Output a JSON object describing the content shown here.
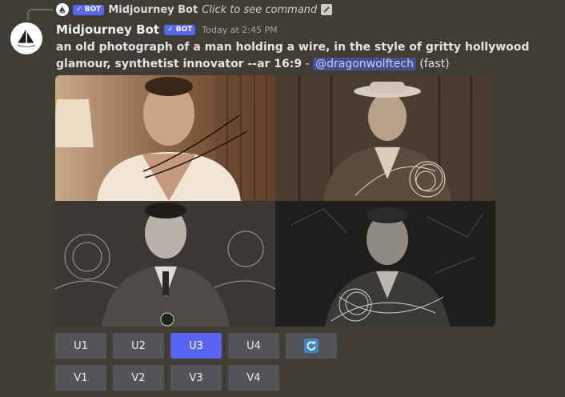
{
  "reply": {
    "bot_badge": "✓ BOT",
    "author": "Midjourney Bot",
    "command_hint": "Click to see command"
  },
  "header": {
    "author": "Midjourney Bot",
    "bot_badge": "✓ BOT",
    "timestamp": "Today at 2:45 PM"
  },
  "message": {
    "prompt": "an old photograph of a man holding a wire, in the style of gritty hollywood glamour, synthetist innovator --ar 16:9",
    "separator": " - ",
    "mention": "@dragonwolftech",
    "speed": "(fast)"
  },
  "grid": {
    "images": [
      "image-1",
      "image-2",
      "image-3",
      "image-4"
    ]
  },
  "buttons": {
    "upscale": [
      "U1",
      "U2",
      "U3",
      "U4"
    ],
    "variation": [
      "V1",
      "V2",
      "V3",
      "V4"
    ],
    "active": "U3",
    "reroll_icon": "refresh-icon"
  },
  "colors": {
    "background": "#3f3d36",
    "blurple": "#5865f2",
    "button": "#54535a",
    "mention_bg": "#4a4e8f"
  }
}
